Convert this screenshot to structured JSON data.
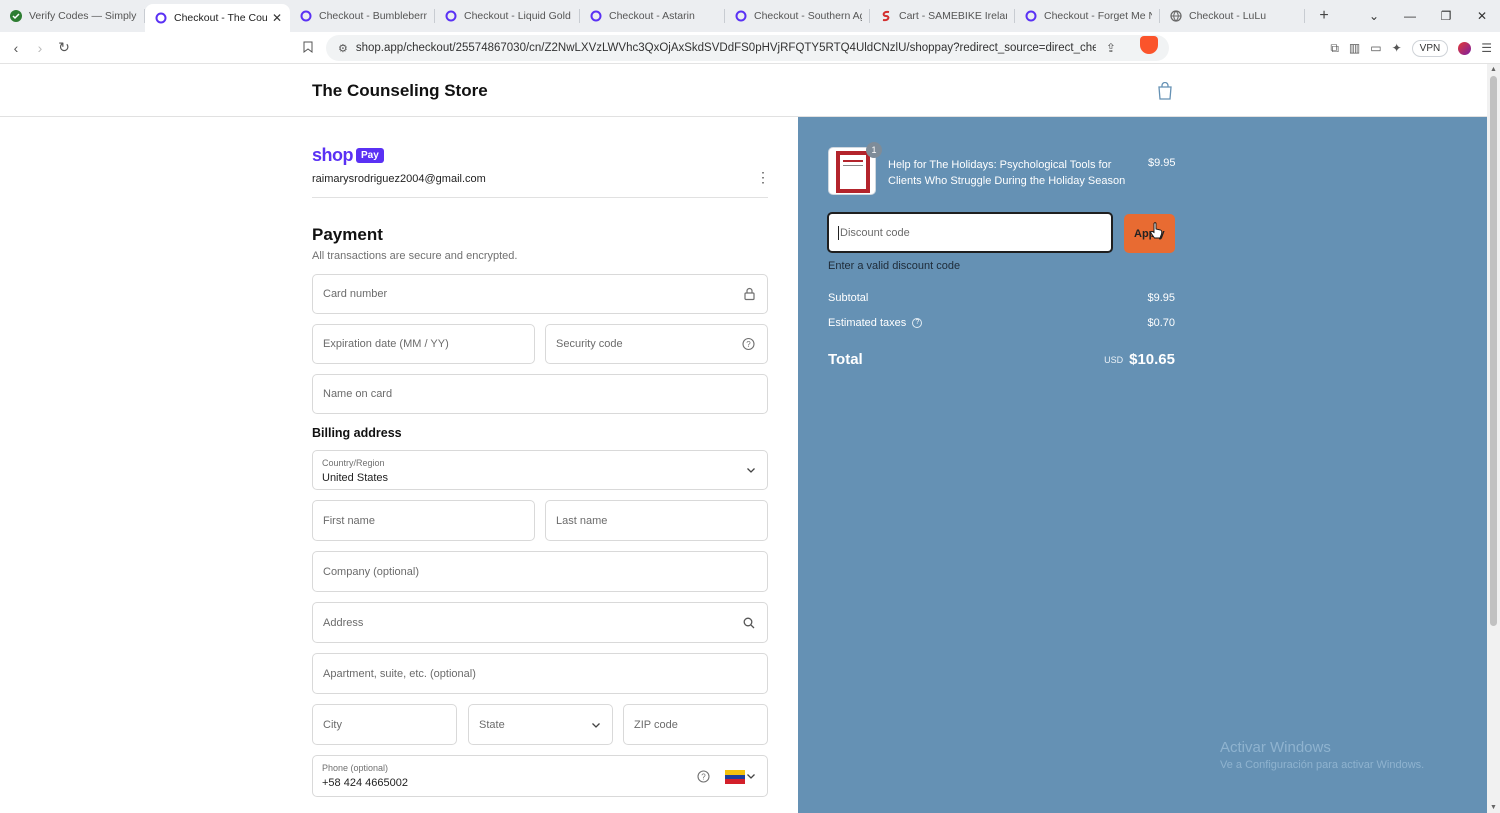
{
  "browser": {
    "tabs": [
      {
        "title": "Verify Codes — SimplyCo",
        "icon": "check-icon"
      },
      {
        "title": "Checkout - The Coun",
        "icon": "shop-icon",
        "active": true
      },
      {
        "title": "Checkout - Bumbleberry",
        "icon": "shop-icon"
      },
      {
        "title": "Checkout - Liquid Gold G",
        "icon": "shop-icon"
      },
      {
        "title": "Checkout - Astarin",
        "icon": "shop-icon"
      },
      {
        "title": "Checkout - Southern Agr",
        "icon": "shop-icon"
      },
      {
        "title": "Cart - SAMEBIKE Ireland S",
        "icon": "s-icon"
      },
      {
        "title": "Checkout - Forget Me Ne",
        "icon": "shop-icon"
      },
      {
        "title": "Checkout - LuLu",
        "icon": "globe-icon"
      }
    ],
    "url": "shop.app/checkout/25574867030/cn/Z2NwLXVzLWVhc3QxOjAxSkdSVDdFS0pHVjRFQTY5RTQ4UldCNzlU/shoppay?redirect_source=direct_checkout_prod...",
    "vpn_label": "VPN",
    "colors": {
      "tab_bg": "#eceef1",
      "brave": "#fb542b"
    }
  },
  "store": {
    "name": "The Counseling Store"
  },
  "shop_pay": {
    "logo_shop": "shop",
    "logo_pay": "Pay",
    "email": "raimarysrodriguez2004@gmail.com",
    "brand_color": "#5a31f4"
  },
  "payment": {
    "heading": "Payment",
    "secure_note": "All transactions are secure and encrypted.",
    "card_number": "Card number",
    "expiration": "Expiration date (MM / YY)",
    "security_code": "Security code",
    "name_on_card": "Name on card"
  },
  "billing": {
    "heading": "Billing address",
    "country_label": "Country/Region",
    "country_value": "United States",
    "first_name": "First name",
    "last_name": "Last name",
    "company": "Company (optional)",
    "address": "Address",
    "apartment": "Apartment, suite, etc. (optional)",
    "city": "City",
    "state": "State",
    "zip": "ZIP code",
    "phone_label": "Phone (optional)",
    "phone_value": "+58 424 4665002"
  },
  "summary": {
    "bg_color": "#6591b4",
    "item": {
      "name": "Help for The Holidays: Psychological Tools for Clients Who Struggle During the Holiday Season",
      "price": "$9.95",
      "quantity": "1"
    },
    "discount_placeholder": "Discount code",
    "apply_label": "Apply",
    "apply_color": "#e86b32",
    "discount_error": "Enter a valid discount code",
    "subtotal_label": "Subtotal",
    "subtotal_value": "$9.95",
    "taxes_label": "Estimated taxes",
    "taxes_value": "$0.70",
    "total_label": "Total",
    "currency": "USD",
    "total_value": "$10.65"
  },
  "watermark": {
    "line1": "Activar Windows",
    "line2": "Ve a Configuración para activar Windows."
  }
}
